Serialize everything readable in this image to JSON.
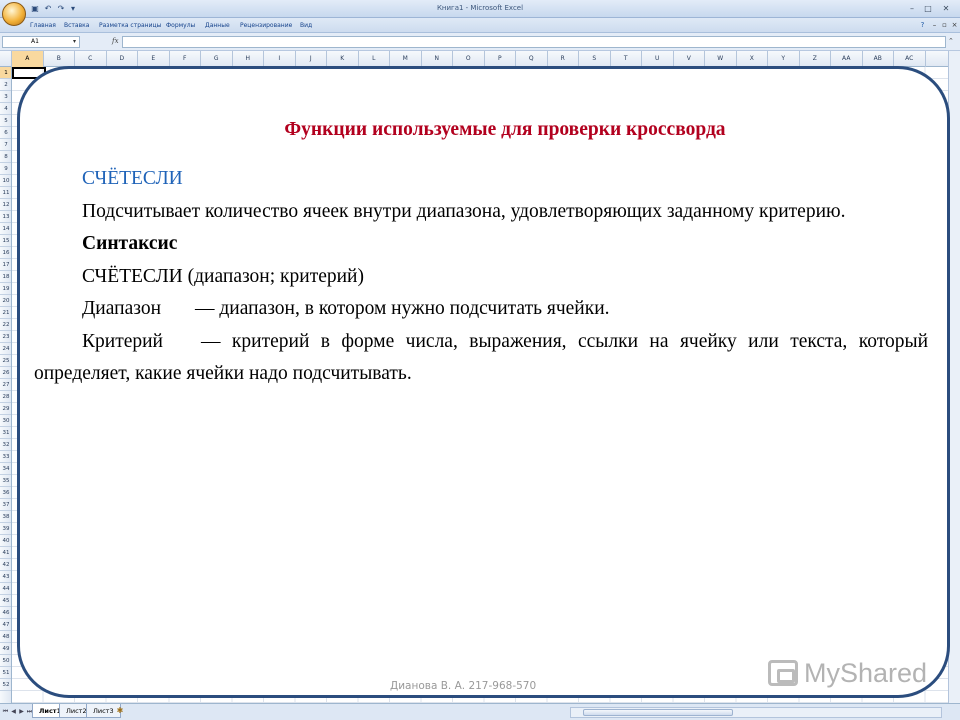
{
  "window": {
    "title": "Книга1 - Microsoft Excel"
  },
  "qat": {
    "save_icon": "save-icon",
    "undo_icon": "undo-icon",
    "redo_icon": "redo-icon"
  },
  "ribbon": {
    "tabs": [
      "Главная",
      "Вставка",
      "Разметка страницы",
      "Формулы",
      "Данные",
      "Рецензирование",
      "Вид"
    ],
    "help_icon": "help-icon"
  },
  "formula_bar": {
    "name_box": "A1",
    "fx_label": "fx",
    "formula": ""
  },
  "columns": [
    "A",
    "B",
    "C",
    "D",
    "E",
    "F",
    "G",
    "H",
    "I",
    "J",
    "K",
    "L",
    "M",
    "N",
    "O",
    "P",
    "Q",
    "R",
    "S",
    "T",
    "U",
    "V",
    "W",
    "X",
    "Y",
    "Z",
    "AA",
    "AB",
    "AC"
  ],
  "row_count": 52,
  "sheets": {
    "tabs": [
      "Лист1",
      "Лист2",
      "Лист3"
    ],
    "active": "Лист1"
  },
  "slide": {
    "title": "Функции используемые для проверки кроссворда",
    "function_name": "СЧЁТЕСЛИ",
    "description": "Подсчитывает количество ячеек внутри диапазона, удовлетворяющих заданному критерию.",
    "syntax_heading": "Синтаксис",
    "syntax": "СЧЁТЕСЛИ (диапазон; критерий)",
    "arg1_name": "Диапазон",
    "arg1_desc": "— диапазон, в котором нужно подсчитать ячейки.",
    "arg2_name": "Критерий",
    "arg2_desc": "— критерий в форме числа, выражения, ссылки на ячейку или текста, который определяет, какие ячейки надо подсчитывать.",
    "footer": "Дианова В. А.  217-968-570",
    "watermark": "MyShared"
  },
  "colors": {
    "title": "#b2001e",
    "function_name": "#1f63b8",
    "panel_border": "#2b4d7e"
  }
}
